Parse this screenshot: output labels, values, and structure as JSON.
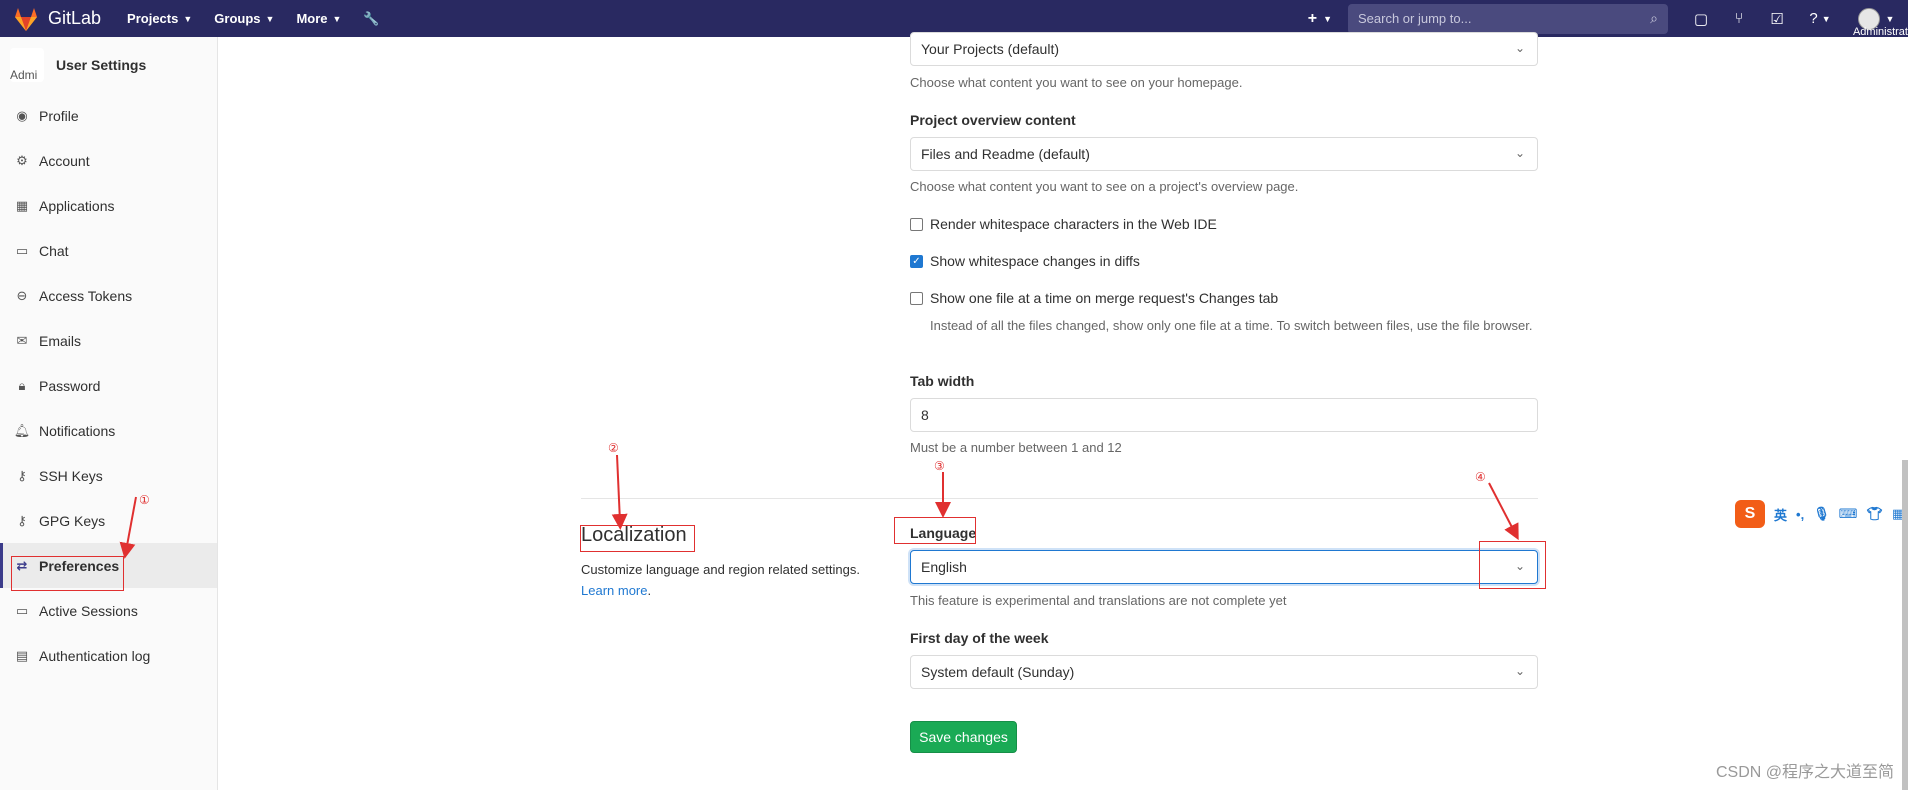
{
  "navbar": {
    "app_name": "GitLab",
    "menu": [
      "Projects",
      "Groups",
      "More"
    ],
    "search_placeholder": "Search or jump to...",
    "user_label": "Administrat"
  },
  "sidebar": {
    "title": "User Settings",
    "avatar_alt": "Admi",
    "items": [
      {
        "label": "Profile",
        "icon": "profile-icon"
      },
      {
        "label": "Account",
        "icon": "account-icon"
      },
      {
        "label": "Applications",
        "icon": "applications-icon"
      },
      {
        "label": "Chat",
        "icon": "chat-icon"
      },
      {
        "label": "Access Tokens",
        "icon": "token-icon"
      },
      {
        "label": "Emails",
        "icon": "mail-icon"
      },
      {
        "label": "Password",
        "icon": "lock-icon"
      },
      {
        "label": "Notifications",
        "icon": "bell-icon"
      },
      {
        "label": "SSH Keys",
        "icon": "key-icon"
      },
      {
        "label": "GPG Keys",
        "icon": "key-icon"
      },
      {
        "label": "Preferences",
        "icon": "preferences-icon"
      },
      {
        "label": "Active Sessions",
        "icon": "monitor-icon"
      },
      {
        "label": "Authentication log",
        "icon": "log-icon"
      }
    ],
    "active": "Preferences"
  },
  "behavior": {
    "homepage_value": "Your Projects (default)",
    "homepage_help": "Choose what content you want to see on your homepage.",
    "overview_label": "Project overview content",
    "overview_value": "Files and Readme (default)",
    "overview_help": "Choose what content you want to see on a project's overview page.",
    "render_whitespace_label": "Render whitespace characters in the Web IDE",
    "render_whitespace_checked": false,
    "show_whitespace_label": "Show whitespace changes in diffs",
    "show_whitespace_checked": true,
    "one_file_label": "Show one file at a time on merge request's Changes tab",
    "one_file_checked": false,
    "one_file_help": "Instead of all the files changed, show only one file at a time. To switch between files, use the file browser.",
    "tab_width_label": "Tab width",
    "tab_width_value": "8",
    "tab_width_help": "Must be a number between 1 and 12"
  },
  "localization": {
    "title": "Localization",
    "description": "Customize language and region related settings.",
    "learn_more": "Learn more",
    "language_label": "Language",
    "language_value": "English",
    "language_help": "This feature is experimental and translations are not complete yet",
    "first_day_label": "First day of the week",
    "first_day_value": "System default (Sunday)"
  },
  "save_label": "Save changes",
  "annotations": [
    "①",
    "②",
    "③",
    "④"
  ],
  "watermark": "CSDN @程序之大道至简",
  "ime": {
    "logo": "S",
    "lang": "英"
  },
  "colors": {
    "navbar": "#292961",
    "save": "#1aaa55",
    "link": "#1f78d1",
    "annotation": "#e03030"
  }
}
